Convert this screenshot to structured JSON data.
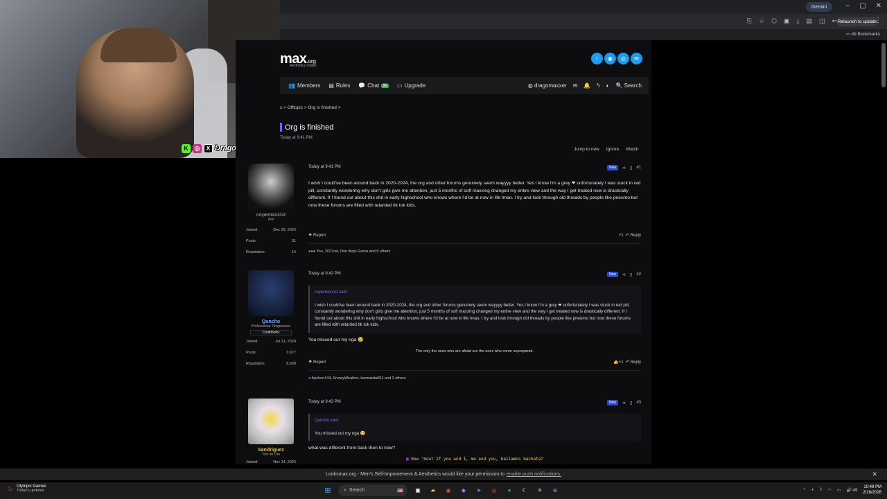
{
  "browser": {
    "gemini": "Gemini",
    "relaunch": "Relaunch to update",
    "all_bookmarks": "All Bookmarks"
  },
  "overlay": {
    "name": "DragoMaxxer"
  },
  "site": {
    "logo": "max",
    "logo_suffix": ".org",
    "tagline": "Aesthetics matter",
    "nav": {
      "members": "Members",
      "rules": "Rules",
      "chat": "Chat",
      "chat_badge": "99",
      "upgrade": "Upgrade",
      "username": "dragomaxxer",
      "search": "Search"
    },
    "breadcrumb": "x  >  Offtopic  >  Org is finished  >",
    "thread_title": "Org is finished",
    "thread_date": "Today at 9:41 PM",
    "tools": {
      "jump": "Jump to new",
      "ignore": "Ignore",
      "watch": "Watch"
    }
  },
  "posts": [
    {
      "user": "copemaxxist",
      "user_title": "Iron",
      "joined_label": "Joined:",
      "joined": "Dec 29, 2025",
      "posts_label": "Posts:",
      "posts": "31",
      "rep_label": "Reputation:",
      "rep": "14",
      "time": "Today at 9:41 PM",
      "new_label": "New",
      "num": "#1",
      "text": "I wish I could've been around back in 2020-2024, the org and other forums genuinely seem wayyyy better. Yes I know I'm a grey ❤ unfortunately I was stuck in red pill, constantly wondering why don't girls give me attention, just 5 months of soft maxxing changed my entire view and the way I get treated now is drastically different. If I found out about this shit in early highschool who knows where I'd be at now in life lmao. I try and look through old threads by people like pneumo but now these forums are filled with retarded tik tok kids.",
      "report": "Report",
      "reply": "Reply",
      "plus": "+1",
      "reactions": "You, 2027cel, Don Alejo Garza and 6 others"
    },
    {
      "user": "Quncho",
      "user_title": "Professional Thugmaxxer",
      "contrib": "Contributor",
      "joined_label": "Joined:",
      "joined": "Jul 21, 2024",
      "posts_label": "Posts:",
      "posts": "3,677",
      "rep_label": "Reputation:",
      "rep": "8,600",
      "time": "Today at 9:42 PM",
      "new_label": "New",
      "num": "#2",
      "quote_author": "copemaxxist said:",
      "quote": "I wish I could've been around back in 2020-2024, the org and other forums genuinely seem wayyyy better. Yes I know I'm a grey ❤ unfortunately I was stuck in red pill, constantly wondering why don't girls give me attention, just 5 months of soft maxxing changed my entire view and the way I get treated now is drastically different. If I found out about this shit in early highschool who knows where I'd be at now in life lmao. I try and look through old threads by people like pneumo but now these forums are filled with retarded tik tok kids.",
      "text": "You missed out my nga 😢",
      "signature": "The only the ones who are afraid are the ones who come unprepared.",
      "report": "Report",
      "reply": "Reply",
      "plus": "+1",
      "reactions": "Apchun144, SnowyWeather, karmacita001 and 2 others"
    },
    {
      "user": "Sandriguez",
      "user_title": "Toto de Oro",
      "joined_label": "Joined:",
      "joined": "Nov 14, 2025",
      "time": "Today at 9:43 PM",
      "new_label": "New",
      "num": "#3",
      "quote_author": "Quncho said:",
      "quote": "You missed out my nga 😢",
      "text": "what was different from back then to now?",
      "lyric": "How 'bout if you and I, me and you, bailamos bachata?"
    }
  ],
  "notification": {
    "text": "Looksmax.org - Men's Self-Improvement & Aesthetics would like your permission to",
    "link": "enable push notifications."
  },
  "taskbar": {
    "weather_title": "Olympic Games",
    "weather_sub": "Today's updates",
    "search": "Search",
    "time": "10:49 PM",
    "date": "2/16/2026",
    "volume": "49"
  }
}
